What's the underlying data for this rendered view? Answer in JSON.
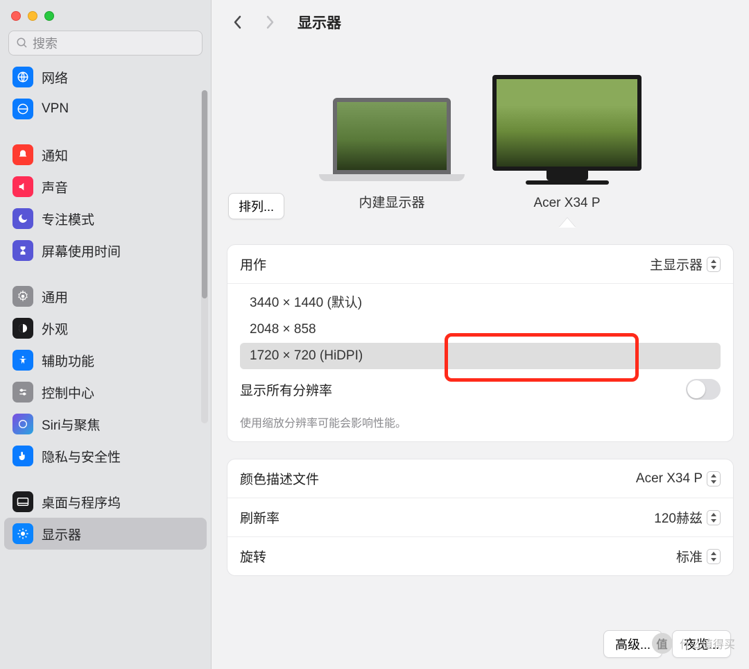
{
  "window": {
    "title": "显示器"
  },
  "search": {
    "placeholder": "搜索"
  },
  "sidebar": {
    "items": [
      {
        "id": "network",
        "label": "网络",
        "color": "#0a7bff"
      },
      {
        "id": "vpn",
        "label": "VPN",
        "color": "#0a7bff"
      },
      {
        "id": "notifications",
        "label": "通知",
        "color": "#ff3b30"
      },
      {
        "id": "sound",
        "label": "声音",
        "color": "#ff2d55"
      },
      {
        "id": "focus",
        "label": "专注模式",
        "color": "#5856d6"
      },
      {
        "id": "screentime",
        "label": "屏幕使用时间",
        "color": "#5856d6"
      },
      {
        "id": "general",
        "label": "通用",
        "color": "#8e8e93"
      },
      {
        "id": "appearance",
        "label": "外观",
        "color": "#1c1c1e"
      },
      {
        "id": "accessibility",
        "label": "辅助功能",
        "color": "#0a7bff"
      },
      {
        "id": "controlcenter",
        "label": "控制中心",
        "color": "#8e8e93"
      },
      {
        "id": "siri",
        "label": "Siri与聚焦",
        "color": "#1c1c1e"
      },
      {
        "id": "privacy",
        "label": "隐私与安全性",
        "color": "#0a7bff"
      },
      {
        "id": "desktop",
        "label": "桌面与程序坞",
        "color": "#1c1c1e"
      },
      {
        "id": "displays",
        "label": "显示器",
        "color": "#0a84ff"
      }
    ]
  },
  "displays": {
    "arrange_button": "排列...",
    "builtin_label": "内建显示器",
    "external_label": "Acer X34 P"
  },
  "settings": {
    "use_as_label": "用作",
    "use_as_value": "主显示器",
    "resolutions": [
      "3440 × 1440 (默认)",
      "2048 × 858",
      "1720 × 720 (HiDPI)"
    ],
    "selected_resolution_index": 2,
    "show_all_label": "显示所有分辨率",
    "show_all_value": false,
    "hint": "使用缩放分辨率可能会影响性能。",
    "color_profile_label": "颜色描述文件",
    "color_profile_value": "Acer X34 P",
    "refresh_label": "刷新率",
    "refresh_value": "120赫兹",
    "rotation_label": "旋转",
    "rotation_value": "标准"
  },
  "footer": {
    "advanced": "高级...",
    "night": "夜览..."
  },
  "watermark": {
    "badge": "值",
    "text": "什么值得买"
  }
}
